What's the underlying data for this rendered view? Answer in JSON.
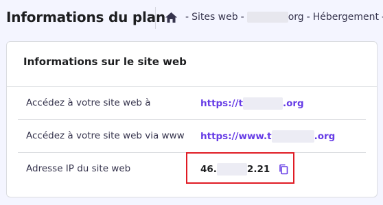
{
  "header": {
    "title": "Informations du plan",
    "breadcrumb": {
      "home_icon": "home-icon",
      "item1": "Sites web",
      "separator": "-",
      "domain_tld": "org",
      "item3": "Hébergement",
      "separator2": "-"
    }
  },
  "card": {
    "title": "Informations sur le site web",
    "rows": [
      {
        "label": "Accédez à votre site web à",
        "link_prefix": "https://t",
        "link_suffix": ".org"
      },
      {
        "label": "Accédez à votre site web via www",
        "link_prefix": "https://www.t",
        "link_suffix": ".org"
      },
      {
        "label": "Adresse IP du site web",
        "value_prefix": "46.",
        "value_suffix": "2.21",
        "icon": "copy-icon"
      }
    ]
  },
  "colors": {
    "link": "#673de6",
    "highlight": "#e01b24",
    "background": "#f4f5ff"
  }
}
